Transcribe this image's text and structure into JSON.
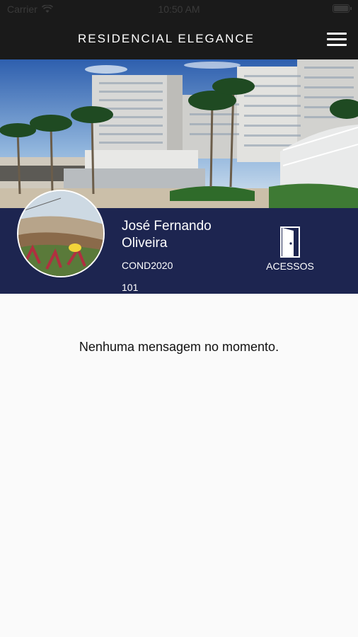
{
  "status_bar": {
    "carrier": "Carrier",
    "time": "10:50 AM",
    "wifi_icon": "wifi-icon",
    "battery_icon": "battery-icon"
  },
  "header": {
    "title": "RESIDENCIAL ELEGANCE",
    "menu_icon": "hamburger-menu-icon"
  },
  "colors": {
    "header_bg": "#1a1a1a",
    "profile_bg": "#1d2550",
    "content_bg": "#fafafa"
  },
  "profile": {
    "name": "José Fernando Oliveira",
    "code": "COND2020",
    "unit": "101",
    "access_label": "ACESSOS",
    "access_icon": "door-icon"
  },
  "content": {
    "empty_message": "Nenhuma mensagem no momento."
  }
}
